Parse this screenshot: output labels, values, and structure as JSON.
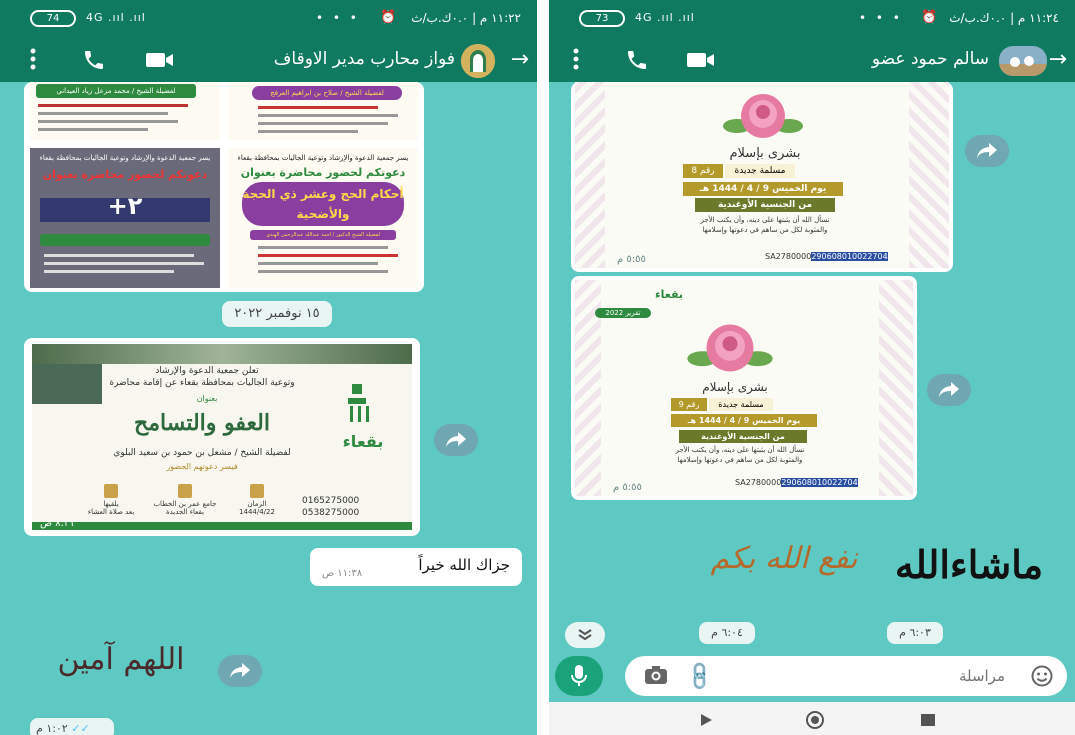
{
  "left": {
    "status": {
      "battery": "74",
      "signal": "4G .ııl .ııl",
      "dots": "• • •",
      "time": "١١:٢٢ م | ٠.٠ك.ب/ث"
    },
    "header": {
      "contact_name": "فواز محارب مدير الاوقاف"
    },
    "posters": {
      "top_left_caption": "لفضيلة الشيخ / محمد مزعل زياد العيداني",
      "top_right_caption": "لفضيلة الشيخ / صلاح بن ابراهيم العرفج",
      "mid_left_invite": "يسر جمعية الدعوة والإرشاد وتوعية الجاليات بمحافظة بقعاء",
      "mid_left_title": "دعوتكم لحضور محاضرة بعنوان",
      "mid_right_invite": "يسر جمعية الدعوة والإرشاد وتوعية الجاليات بمحافظة بقعاء",
      "mid_right_title": "دعوتكم لحضور محاضرة بعنوان",
      "mid_right_lecture": "أحكام الحج وعشر ذي الحجة والأضحية",
      "mid_right_sheikh": "لفضيلة الشيخ الدكتور / احمد عبدالله عبدالرحمن الهندي",
      "plus_count": "+٢"
    },
    "date_chip": "١٥ نوفمبر ٢٠٢٢",
    "big_poster": {
      "org_line1": "تعلن جمعية الدعوة والإرشاد",
      "org_line2": "وتوعية الجاليات بمحافظة بقعاء عن إقامة محاضرة",
      "subtitle": "بعنوان",
      "title": "العفو والتسامح",
      "sheikh": "لفضيلة الشيخ / مشعل بن حمود بن سعيد البلوي",
      "invite": "فيسر دعوتهم الحضور",
      "logo": "بقعاء",
      "phone1": "0165275000",
      "phone2": "0538275000",
      "info1_label": "الزمان",
      "info1_value": "1444/4/22",
      "info2_label": "جامع عمر بن الخطاب",
      "info2_value": "بقعاء الجديدة",
      "info3_label": "يلقيها",
      "info3_value": "بعد صلاة العشاء",
      "time": "٨:٢١ ص"
    },
    "reply": {
      "text": "جزاك الله خيراً",
      "time": "١١:٣٨ ص"
    },
    "sticker_text": "اللهم آمين",
    "last_time": "١:٠٢ م"
  },
  "right": {
    "status": {
      "battery": "73",
      "signal": "4G .ııl .ııl",
      "dots": "• • •",
      "time": "١١:٢٤ م | ٠.٠ك.ب/ث"
    },
    "header": {
      "contact_name": "سالم حمود عضو"
    },
    "card1": {
      "title": "بشرى بإسلام",
      "status": "مسلمة جديدة",
      "number": "رقم 8",
      "date": "يوم الخميس 9 / 4 / 1444 هـ",
      "nationality": "من الجنسية الأوغندية",
      "prayer1": "نسأل الله أن يثبتها على دينه، وأن يكتب الأجر",
      "prayer2": "والمثوبة لكل من ساهم في دعوتها وإسلامها",
      "iban_prefix": "SA2780000",
      "iban_highlight": "290608010022704",
      "time": "٥:٥٥ م"
    },
    "card2": {
      "title": "بشرى بإسلام",
      "status": "مسلمة جديدة",
      "number": "رقم 9",
      "date": "يوم الخميس 9 / 4 / 1444 هـ",
      "nationality": "من الجنسية الأوغندية",
      "prayer1": "نسأل الله أن يثبتها على دينه، وأن يكتب الأجر",
      "prayer2": "والمثوبة لكل من ساهم في دعوتها وإسلامها",
      "iban_prefix": "SA2780000",
      "iban_highlight": "290608010022704",
      "report_label": "تقرير 2022",
      "logo": "بقعاء",
      "time": "٥:٥٥ م"
    },
    "sticker1": "ماشاءالله",
    "sticker2": "نفع الله بكم",
    "time_a": "٦:٠٣ م",
    "time_b": "٦:٠٤ م",
    "input": {
      "placeholder": "مراسلة"
    },
    "colors": {
      "accent": "#0f7a5f",
      "chat_bg": "#5ec9c3",
      "mic": "#1aa37a"
    }
  }
}
